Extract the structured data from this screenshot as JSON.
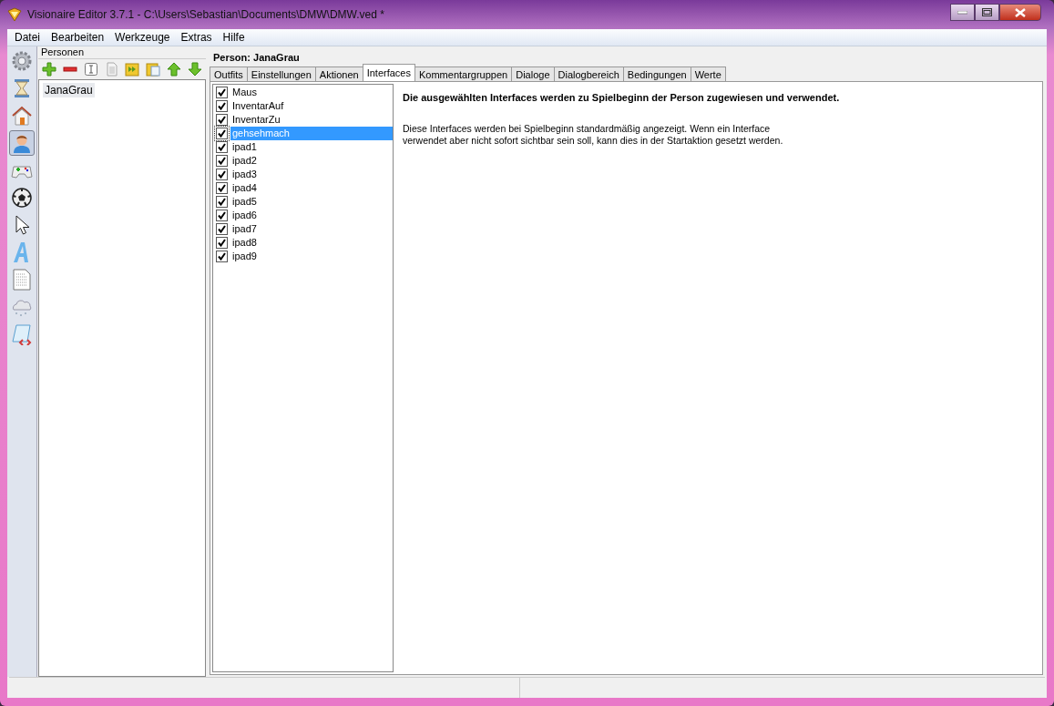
{
  "window": {
    "title": "Visionaire Editor 3.7.1 - C:\\Users\\Sebastian\\Documents\\DMW\\DMW.ved *"
  },
  "menu": [
    "Datei",
    "Bearbeiten",
    "Werkzeuge",
    "Extras",
    "Hilfe"
  ],
  "tools": [
    {
      "kind": "gear",
      "selected": false
    },
    {
      "kind": "hourglass",
      "selected": false
    },
    {
      "kind": "house",
      "selected": false
    },
    {
      "kind": "person",
      "selected": true
    },
    {
      "kind": "gamepad",
      "selected": false
    },
    {
      "kind": "ball",
      "selected": false
    },
    {
      "kind": "cursor",
      "selected": false
    },
    {
      "kind": "letter",
      "selected": false
    },
    {
      "kind": "document",
      "selected": false
    },
    {
      "kind": "cloud",
      "selected": false
    },
    {
      "kind": "scroll",
      "selected": false
    }
  ],
  "panel": {
    "title": "Personen",
    "toolbar": [
      {
        "kind": "add"
      },
      {
        "kind": "remove"
      },
      {
        "kind": "rename"
      },
      {
        "kind": "copy"
      },
      {
        "kind": "duplicate"
      },
      {
        "kind": "paste"
      },
      {
        "kind": "up"
      },
      {
        "kind": "down"
      }
    ],
    "items": [
      {
        "label": "JanaGrau",
        "selected": true
      }
    ]
  },
  "heading": "Person: JanaGrau",
  "tabs": [
    {
      "label": "Outfits",
      "selected": false
    },
    {
      "label": "Einstellungen",
      "selected": false
    },
    {
      "label": "Aktionen",
      "selected": false
    },
    {
      "label": "Interfaces",
      "selected": true
    },
    {
      "label": "Kommentargruppen",
      "selected": false
    },
    {
      "label": "Dialoge",
      "selected": false
    },
    {
      "label": "Dialogbereich",
      "selected": false
    },
    {
      "label": "Bedingungen",
      "selected": false
    },
    {
      "label": "Werte",
      "selected": false
    }
  ],
  "interfaces": [
    {
      "label": "Maus",
      "checked": true,
      "selected": false
    },
    {
      "label": "InventarAuf",
      "checked": true,
      "selected": false
    },
    {
      "label": "InventarZu",
      "checked": true,
      "selected": false
    },
    {
      "label": "gehsehmach",
      "checked": true,
      "selected": true
    },
    {
      "label": "ipad1",
      "checked": true,
      "selected": false
    },
    {
      "label": "ipad2",
      "checked": true,
      "selected": false
    },
    {
      "label": "ipad3",
      "checked": true,
      "selected": false
    },
    {
      "label": "ipad4",
      "checked": true,
      "selected": false
    },
    {
      "label": "ipad5",
      "checked": true,
      "selected": false
    },
    {
      "label": "ipad6",
      "checked": true,
      "selected": false
    },
    {
      "label": "ipad7",
      "checked": true,
      "selected": false
    },
    {
      "label": "ipad8",
      "checked": true,
      "selected": false
    },
    {
      "label": "ipad9",
      "checked": true,
      "selected": false
    }
  ],
  "description": {
    "title": "Die ausgewählten Interfaces werden zu Spielbeginn der Person zugewiesen und verwendet.",
    "text": "Diese Interfaces werden bei Spielbeginn standardmäßig angezeigt. Wenn ein Interface verwendet aber nicht sofort sichtbar sein soll, kann dies in der Startaktion gesetzt werden."
  }
}
